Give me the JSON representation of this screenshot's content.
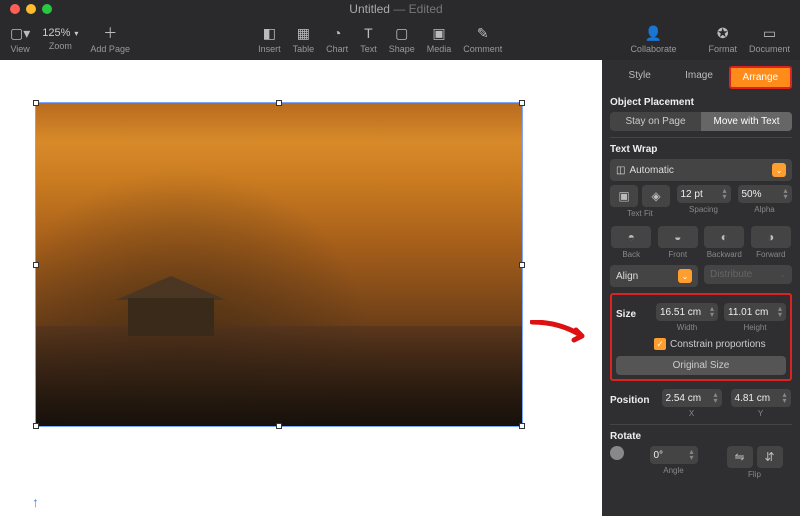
{
  "window": {
    "title": "Untitled",
    "state": "Edited"
  },
  "toolbar": {
    "view": "View",
    "zoom_value": "125%",
    "zoom_label": "Zoom",
    "add_page": "Add Page",
    "insert": "Insert",
    "table": "Table",
    "chart": "Chart",
    "text": "Text",
    "shape": "Shape",
    "media": "Media",
    "comment": "Comment",
    "collaborate": "Collaborate",
    "format": "Format",
    "document": "Document"
  },
  "inspector": {
    "tabs": {
      "style": "Style",
      "image": "Image",
      "arrange": "Arrange"
    },
    "placement": {
      "title": "Object Placement",
      "stay": "Stay on Page",
      "move": "Move with Text"
    },
    "wrap": {
      "title": "Text Wrap",
      "mode": "Automatic",
      "textfit": "Text Fit",
      "spacing_label": "Spacing",
      "spacing_value": "12 pt",
      "alpha_label": "Alpha",
      "alpha_value": "50%"
    },
    "order": {
      "back": "Back",
      "front": "Front",
      "backward": "Backward",
      "forward": "Forward"
    },
    "align": {
      "align": "Align",
      "distribute": "Distribute"
    },
    "size": {
      "title": "Size",
      "width_value": "16.51 cm",
      "width_label": "Width",
      "height_value": "11.01 cm",
      "height_label": "Height",
      "constrain": "Constrain proportions",
      "original": "Original Size"
    },
    "position": {
      "title": "Position",
      "x_value": "2.54 cm",
      "x_label": "X",
      "y_value": "4.81 cm",
      "y_label": "Y"
    },
    "rotate": {
      "title": "Rotate",
      "angle_value": "0°",
      "angle_label": "Angle",
      "flip_label": "Flip"
    }
  }
}
